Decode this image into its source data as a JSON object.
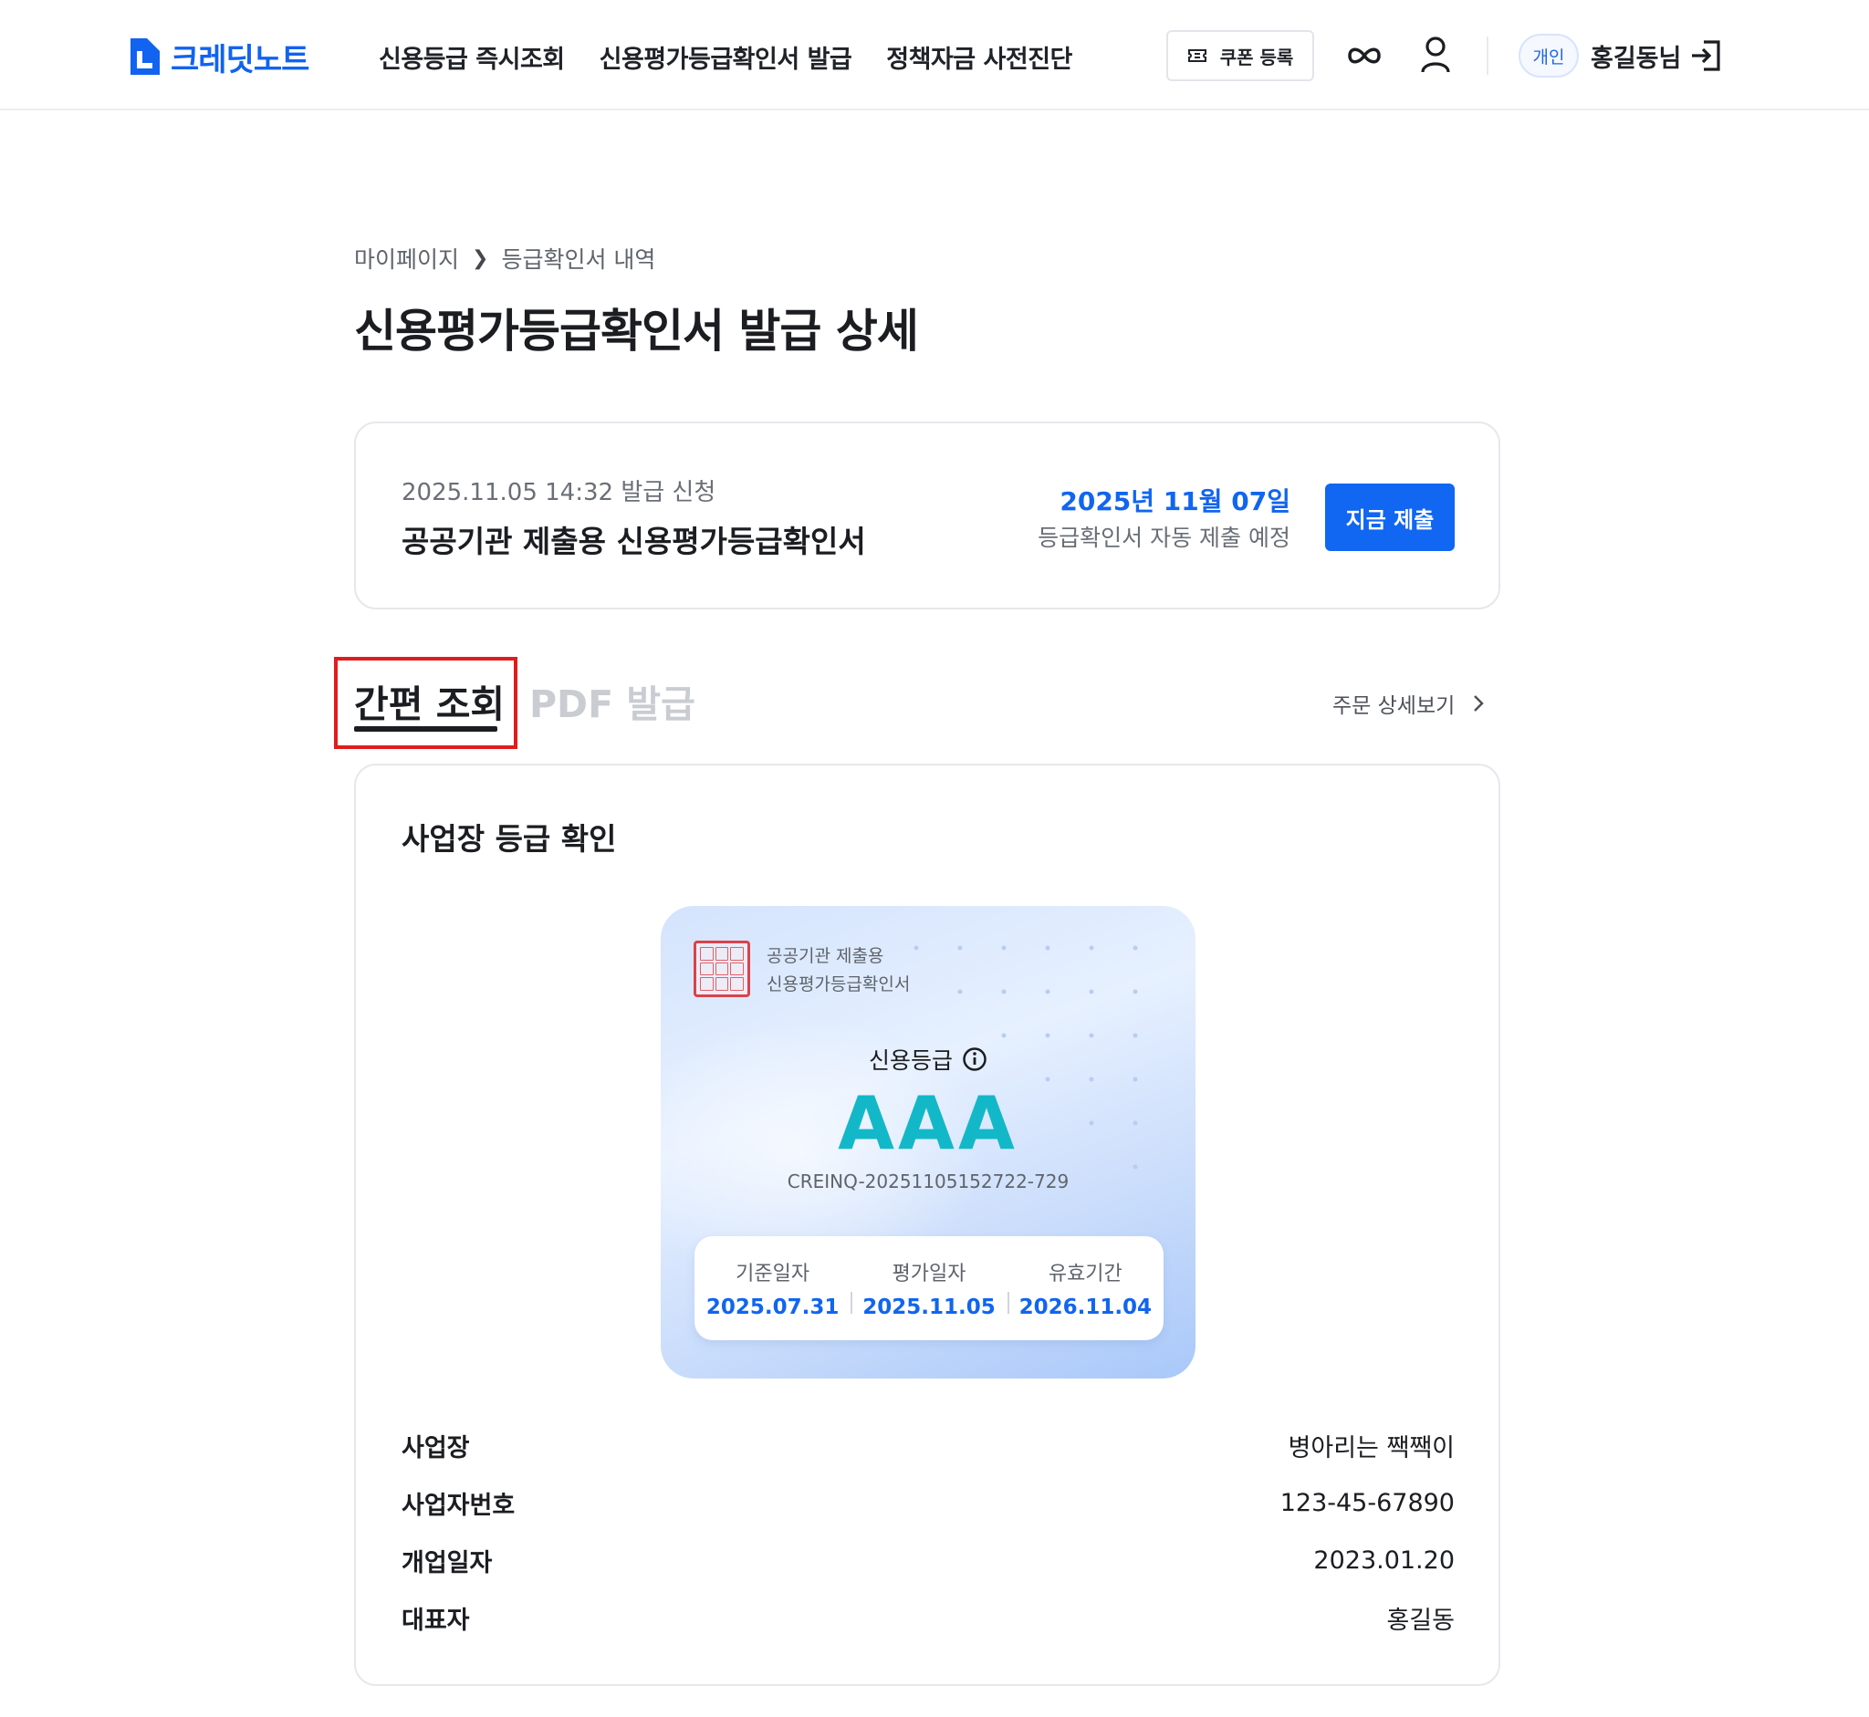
{
  "header": {
    "logo_text": "크레딧노트",
    "nav": [
      "신용등급 즉시조회",
      "신용평가등급확인서 발급",
      "정책자금 사전진단"
    ],
    "coupon_label": "쿠폰 등록",
    "user_badge": "개인",
    "user_name": "홍길동님"
  },
  "breadcrumb": {
    "parent": "마이페이지",
    "current": "등급확인서 내역"
  },
  "page_title": "신용평가등급확인서 발급 상세",
  "summary": {
    "request_meta": "2025.11.05 14:32 발급 신청",
    "product_name": "공공기관 제출용 신용평가등급확인서",
    "due_date": "2025년 11월 07일",
    "due_desc": "등급확인서 자동 제출 예정",
    "submit_label": "지금 제출"
  },
  "tabs": {
    "active": "간편 조회",
    "inactive": "PDF 발급",
    "order_detail": "주문 상세보기"
  },
  "detail": {
    "section_title": "사업장 등급 확인",
    "certificate": {
      "subtitle_1": "공공기관 제출용",
      "subtitle_2": "신용평가등급확인서",
      "grade_label": "신용등급",
      "grade": "AAA",
      "code": "CREINQ-20251105152722-729",
      "dates": [
        {
          "label": "기준일자",
          "value": "2025.07.31"
        },
        {
          "label": "평가일자",
          "value": "2025.11.05"
        },
        {
          "label": "유효기간",
          "value": "2026.11.04"
        }
      ]
    },
    "info": [
      {
        "label": "사업장",
        "value": "병아리는 짹짹이"
      },
      {
        "label": "사업자번호",
        "value": "123-45-67890"
      },
      {
        "label": "개업일자",
        "value": "2023.01.20"
      },
      {
        "label": "대표자",
        "value": "홍길동"
      }
    ]
  },
  "colors": {
    "brand": "#1166f2",
    "grade": "#13b8c8",
    "highlight": "#e21c1c"
  },
  "icons": [
    "logo-icon",
    "ticket-icon",
    "infinity-icon",
    "user-icon",
    "logout-icon",
    "chevron-right-icon",
    "info-icon",
    "seal-icon"
  ]
}
